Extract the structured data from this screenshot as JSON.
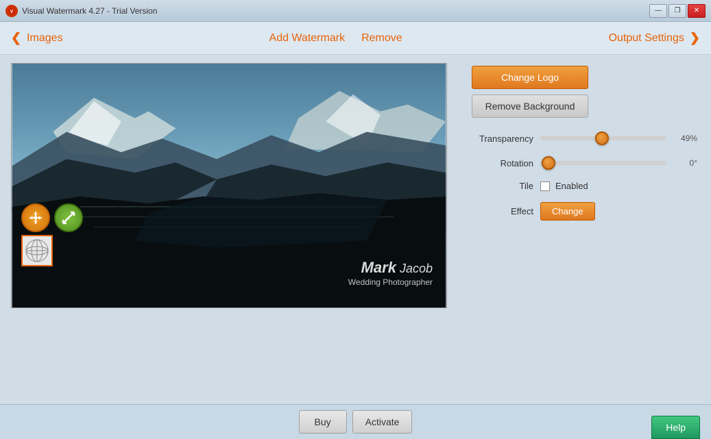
{
  "titleBar": {
    "title": "Visual Watermark 4.27 - Trial Version",
    "appIcon": "🔴",
    "controls": {
      "minimize": "—",
      "restore": "❐",
      "close": "✕"
    }
  },
  "navBar": {
    "back": {
      "arrow": "❮",
      "label": "Images"
    },
    "center": {
      "addWatermark": "Add Watermark",
      "remove": "Remove"
    },
    "forward": {
      "label": "Output Settings",
      "arrow": "❯"
    }
  },
  "rightPanel": {
    "changeLogo": "Change Logo",
    "removeBackground": "Remove Background",
    "transparency": {
      "label": "Transparency",
      "value": "49%",
      "percent": 49
    },
    "rotation": {
      "label": "Rotation",
      "value": "0°",
      "percent": 0
    },
    "tile": {
      "label": "Tile",
      "checkboxLabel": "Enabled"
    },
    "effect": {
      "label": "Effect",
      "buttonLabel": "Change"
    }
  },
  "watermark": {
    "boldText": "Mark",
    "normalText": " Jacob",
    "subText": "Wedding Photographer"
  },
  "bottomBar": {
    "buy": "Buy",
    "activate": "Activate",
    "help": "Help"
  }
}
